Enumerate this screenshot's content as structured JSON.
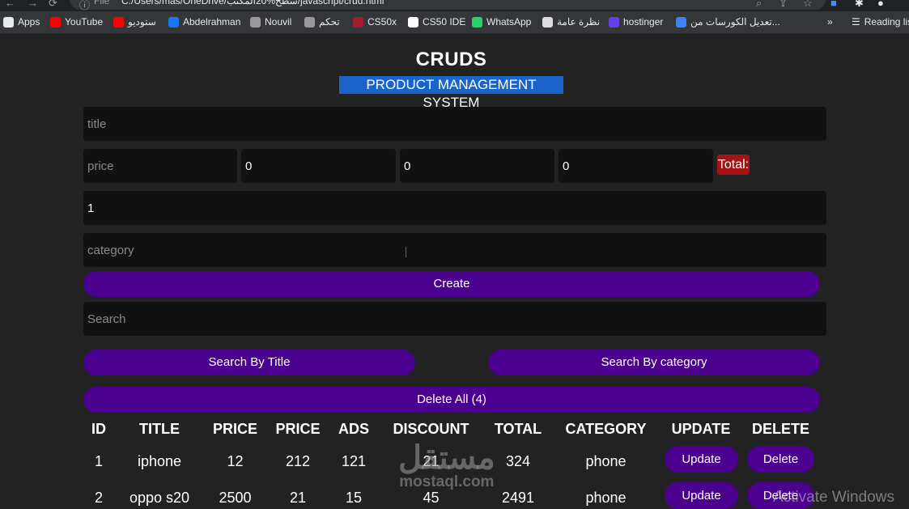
{
  "browser": {
    "url_prefix": "File",
    "url": "C:/Users/mas/OneDrive/سطح%20المكتب/javascript/crud.html",
    "bookmarks": [
      {
        "label": "Apps",
        "icon": "apps-grid-icon",
        "color": "#e8eaed"
      },
      {
        "label": "YouTube",
        "icon": "youtube-icon",
        "color": "#ff0000"
      },
      {
        "label": "ستوديو",
        "icon": "youtube-icon",
        "color": "#ff0000"
      },
      {
        "label": "Abdelrahman",
        "icon": "facebook-icon",
        "color": "#1877f2"
      },
      {
        "label": "Nouvil",
        "icon": "site-icon",
        "color": "#999999"
      },
      {
        "label": "تحكم",
        "icon": "site-icon",
        "color": "#999999"
      },
      {
        "label": "CS50x",
        "icon": "cs50-icon",
        "color": "#a51c30"
      },
      {
        "label": "CS50 IDE",
        "icon": "cs50-ide-icon",
        "color": "#ffffff"
      },
      {
        "label": "WhatsApp",
        "icon": "whatsapp-icon",
        "color": "#25d366"
      },
      {
        "label": "نظرة عامة",
        "icon": "car-icon",
        "color": "#dddddd"
      },
      {
        "label": "hostinger",
        "icon": "hostinger-icon",
        "color": "#673de6"
      },
      {
        "label": "تعديل الكورسات من...",
        "icon": "site-icon",
        "color": "#3b82f6"
      }
    ],
    "more": "»",
    "reading_list": "Reading list"
  },
  "page": {
    "title": "CRUDS",
    "subtitle": "PRODUCT MANAGEMENT SYSTEM",
    "inputs": {
      "title_placeholder": "title",
      "price_placeholder": "price",
      "taxes_value": "0",
      "ads_value": "0",
      "discount_value": "0",
      "count_value": "1",
      "category_placeholder": "category",
      "search_placeholder": "Search"
    },
    "total_label": "Total:",
    "create_label": "Create",
    "search_by_title": "Search By Title",
    "search_by_category": "Search By category",
    "delete_all": "Delete All (4)"
  },
  "table": {
    "headers": [
      "ID",
      "TITLE",
      "PRICE",
      "PRICE",
      "ADS",
      "DISCOUNT",
      "TOTAL",
      "CATEGORY",
      "UPDATE",
      "DELETE"
    ],
    "rows": [
      {
        "id": "1",
        "title": "iphone",
        "price": "12",
        "taxes": "212",
        "ads": "121",
        "discount": "21",
        "total": "324",
        "category": "phone",
        "update": "Update",
        "delete": "Delete"
      },
      {
        "id": "2",
        "title": "oppo s20",
        "price": "2500",
        "taxes": "21",
        "ads": "15",
        "discount": "45",
        "total": "2491",
        "category": "phone",
        "update": "Update",
        "delete": "Delete"
      }
    ]
  },
  "overlay": {
    "watermark_ar": "مستقل",
    "watermark_en": "mostaql.com",
    "activate": "Activate Windows"
  },
  "colors": {
    "background": "#222222",
    "input_bg": "#111111",
    "button_purple": "#4b008f",
    "total_red": "#a31515",
    "subtitle_highlight": "#1a64c9"
  }
}
